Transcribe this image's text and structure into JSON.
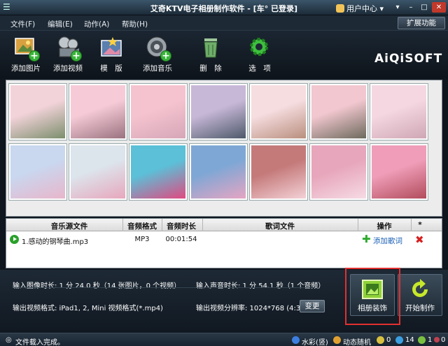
{
  "window": {
    "title": "艾奇KTV电子相册制作软件 - [车° 已登录]",
    "user_center": "用户中心"
  },
  "menu": {
    "file": "文件(F)",
    "edit": "编辑(E)",
    "action": "动作(A)",
    "help": "帮助(H)",
    "extend": "扩展功能"
  },
  "toolbar": {
    "add_image": "添加图片",
    "add_video": "添加视频",
    "template": "模　版",
    "add_music": "添加音乐",
    "delete": "删　除",
    "options": "选　项"
  },
  "logo": "AiQiSOFT",
  "thumbnails": [
    {
      "c1": "#f3d3da",
      "c2": "#7c8f6d"
    },
    {
      "c1": "#f6cbd7",
      "c2": "#9a7380"
    },
    {
      "c1": "#f5c3cf",
      "c2": "#d6a6b8"
    },
    {
      "c1": "#c8b8d8",
      "c2": "#4e5a6b"
    },
    {
      "c1": "#f6dde0",
      "c2": "#b98f7e"
    },
    {
      "c1": "#f2c7cf",
      "c2": "#6d6a5d"
    },
    {
      "c1": "#f4d7e1",
      "c2": "#cfa7b4"
    },
    {
      "c1": "#c9d7ef",
      "c2": "#e8b6cb"
    },
    {
      "c1": "#dce4ec",
      "c2": "#e7a7bc"
    },
    {
      "c1": "#5bc0d8",
      "c2": "#e04a80"
    },
    {
      "c1": "#7fa7d5",
      "c2": "#e6a5c3"
    },
    {
      "c1": "#c57a7a",
      "c2": "#f3d1d7"
    },
    {
      "c1": "#e7a6bb",
      "c2": "#f6dbe4"
    },
    {
      "c1": "#ef9db8",
      "c2": "#b24c5c"
    }
  ],
  "music_table": {
    "headers": {
      "source": "音乐源文件",
      "format": "音频格式",
      "duration": "音频时长",
      "lyric": "歌词文件",
      "action": "操作",
      "star": "*"
    },
    "rows": [
      {
        "source": "1.感动的钢琴曲.mp3",
        "format": "MP3",
        "duration": "00:01:54",
        "lyric": "",
        "action": "添加歌词"
      }
    ]
  },
  "info": {
    "image_duration": "输入图像时长: 1 分 24.0 秒（14 张图片，0 个视频）",
    "audio_duration": "输入声音时长: 1 分 54.1 秒（1 个音频）",
    "video_format": "输出视频格式: iPad1, 2, Mini 视频格式(*.mp4)",
    "resolution": "输出视频分辨率: 1024*768 (4:3)",
    "change": "变更"
  },
  "actions": {
    "decorate": "相册装饰",
    "start": "开始制作"
  },
  "status": {
    "message": "文件载入完成。",
    "watercolor": "水彩(竖)",
    "dynamic": "动态随机",
    "count_a": "0",
    "count_b": "14",
    "count_c": "1",
    "count_d": "0"
  }
}
